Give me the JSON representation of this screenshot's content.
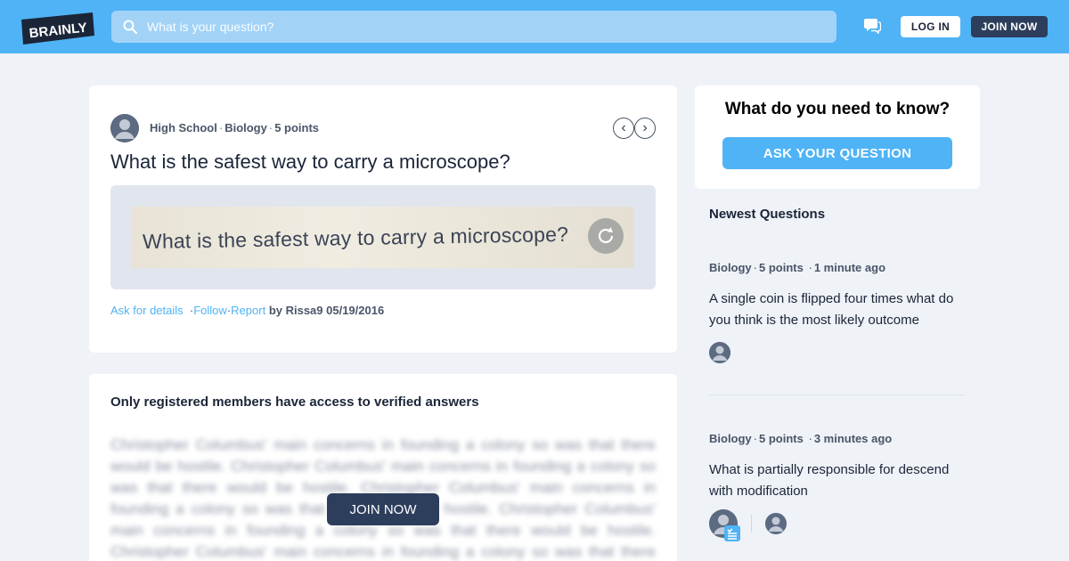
{
  "header": {
    "logo_text": "BRAINLY",
    "search_placeholder": "What is your question?",
    "login_label": "LOG IN",
    "join_label": "JOIN NOW"
  },
  "question": {
    "level": "High School",
    "subject": "Biology",
    "points": "5 points",
    "title": "What is the safest way to carry a microscope?",
    "attachment_text": "What is the safest way to carry a microscope?",
    "actions": {
      "ask_details": "Ask for details",
      "follow": "Follow",
      "report": "Report"
    },
    "author_line": "by Rissa9 05/19/2016"
  },
  "answers": {
    "heading": "Only registered members have access to verified answers",
    "blurred_text": "Christopher Columbus' main concerns in founding a colony so was that there would be hostile. Christopher Columbus' main concerns in founding a colony so was that there would be hostile. Christopher Columbus' main concerns in founding a colony so was that there would be hostile. Christopher Columbus' main concerns in founding a colony so was that there would be hostile. Christopher Columbus' main concerns in founding a colony so was that there would be hostile.",
    "join_label": "JOIN NOW"
  },
  "sidebar": {
    "ask_title": "What do you need to know?",
    "ask_button": "ASK YOUR QUESTION",
    "newest_heading": "Newest Questions",
    "items": [
      {
        "subject": "Biology",
        "points": "5 points",
        "time": "1 minute ago",
        "text": "A single coin is flipped four times what do you think is the most likely outcome"
      },
      {
        "subject": "Biology",
        "points": "5 points",
        "time": "3 minutes ago",
        "text": "What is partially responsible for descend with modification"
      }
    ]
  },
  "colors": {
    "brand_blue": "#4fb3f6",
    "navy": "#2c3e5b",
    "page_bg": "#eff2f7"
  },
  "icons": [
    "search-icon",
    "chat-icon",
    "chevron-left-icon",
    "chevron-right-icon",
    "rotate-icon",
    "avatar-icon",
    "verified-check-icon"
  ]
}
